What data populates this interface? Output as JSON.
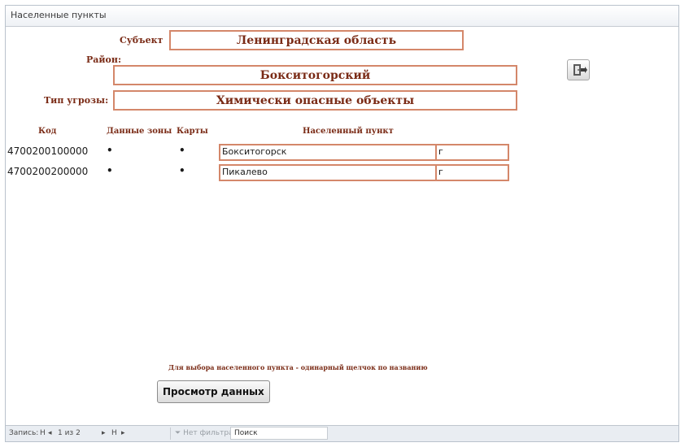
{
  "window": {
    "title": "Населенные пункты"
  },
  "filters": {
    "subject_label": "Субъект",
    "subject_value": "Ленинградская область",
    "district_label": "Район:",
    "district_value": "Бокситогорский",
    "threat_label": "Тип угрозы:",
    "threat_value": "Химически опасные объекты"
  },
  "table": {
    "headers": {
      "code": "Код",
      "zone_data": "Данные зоны",
      "maps": "Карты",
      "settlement": "Населенный пункт"
    },
    "rows": [
      {
        "code": "4700200100000",
        "zone_mark": "•",
        "map_mark": "•",
        "name": "Бокситогорск",
        "type": "г"
      },
      {
        "code": "4700200200000",
        "zone_mark": "•",
        "map_mark": "•",
        "name": "Пикалево",
        "type": "г"
      }
    ]
  },
  "hint": "Для выбора населенного пункта - одинарный щелчок по названию",
  "buttons": {
    "view_data": "Просмотр данных"
  },
  "statusbar": {
    "record_label": "Запись:",
    "nav_first": "H",
    "nav_prev": "◂",
    "record_position": "1 из 2",
    "nav_next": "▸",
    "nav_last": "H",
    "nav_new": "▸",
    "filter": "Нет фильтра",
    "search": "Поиск"
  },
  "colors": {
    "label": "#7a2b16",
    "border": "#d4876a"
  }
}
